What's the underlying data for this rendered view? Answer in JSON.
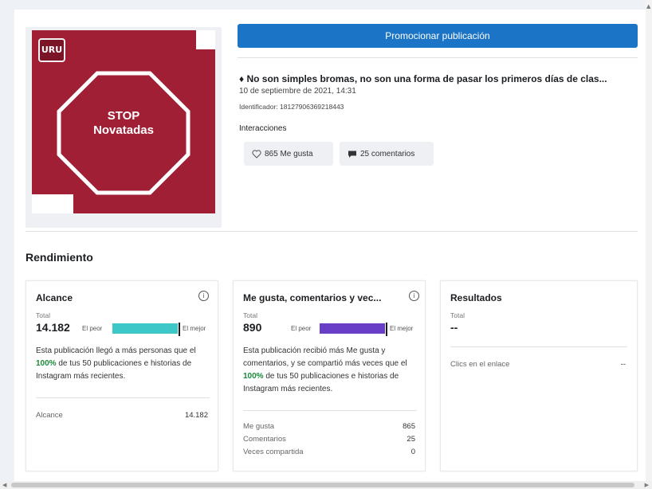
{
  "post": {
    "promote_button": "Promocionar publicación",
    "title": "♦ No son simples bromas, no son una forma de pasar los primeros días de clas...",
    "date": "10 de septiembre de 2021, 14:31",
    "identifier": "Identificador: 18127906369218443",
    "interactions_label": "Interacciones",
    "likes_chip": "865 Me gusta",
    "comments_chip": "25 comentarios",
    "image": {
      "logo_text": "URU",
      "sign_line1": "STOP",
      "sign_line2": "Novatadas",
      "background_color": "#a11f35"
    }
  },
  "performance": {
    "section_title": "Rendimiento",
    "cards": [
      {
        "title": "Alcance",
        "total_label": "Total",
        "total_value": "14.182",
        "worst_label": "El peor",
        "best_label": "El mejor",
        "bar_color": "#3dc7c7",
        "bar_fill_percent": 100,
        "desc_before": "Esta publicación llegó a más personas que el ",
        "desc_highlight": "100%",
        "desc_after": " de tus 50 publicaciones e historias de Instagram más recientes.",
        "rows": [
          {
            "label": "Alcance",
            "value": "14.182"
          }
        ]
      },
      {
        "title": "Me gusta, comentarios y vec...",
        "total_label": "Total",
        "total_value": "890",
        "worst_label": "El peor",
        "best_label": "El mejor",
        "bar_color": "#6a3fc7",
        "bar_fill_percent": 100,
        "desc_before": "Esta publicación recibió más Me gusta y comentarios, y se compartió más veces que el ",
        "desc_highlight": "100%",
        "desc_after": " de tus 50 publicaciones e historias de Instagram más recientes.",
        "rows": [
          {
            "label": "Me gusta",
            "value": "865"
          },
          {
            "label": "Comentarios",
            "value": "25"
          },
          {
            "label": "Veces compartida",
            "value": "0"
          }
        ]
      },
      {
        "title": "Resultados",
        "total_label": "Total",
        "total_value": "--",
        "rows": [
          {
            "label": "Clics en el enlace",
            "value": "--"
          }
        ]
      }
    ]
  }
}
